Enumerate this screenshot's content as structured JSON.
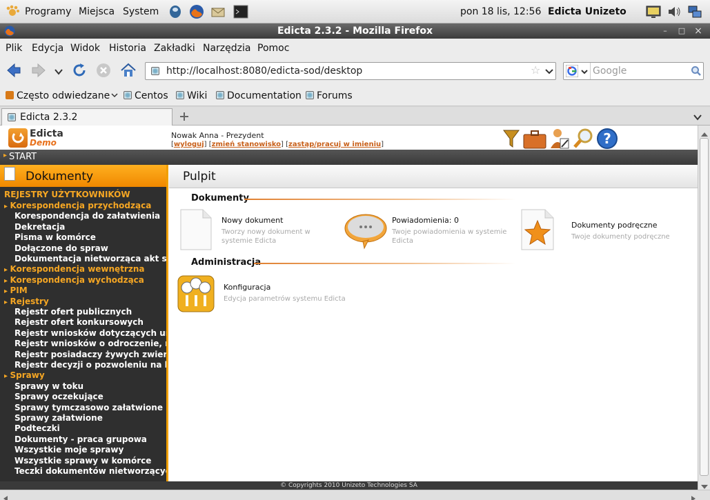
{
  "panel": {
    "menus": [
      "Programy",
      "Miejsca",
      "System"
    ],
    "clock": "pon 18 lis, 12:56",
    "user": "Edicta Unizeto"
  },
  "window": {
    "title": "Edicta 2.3.2 - Mozilla Firefox",
    "min": "–",
    "max": "□",
    "close": "×"
  },
  "menubar": [
    "Plik",
    "Edycja",
    "Widok",
    "Historia",
    "Zakładki",
    "Narzędzia",
    "Pomoc"
  ],
  "nav": {
    "url": "http://localhost:8080/edicta-sod/desktop",
    "search_placeholder": "Google"
  },
  "bookmarks": [
    "Często odwiedzane",
    "Centos",
    "Wiki",
    "Documentation",
    "Forums"
  ],
  "tabs": [
    {
      "label": "Edicta 2.3.2"
    }
  ],
  "app": {
    "logo_line1": "Edicta",
    "logo_line2": "Demo",
    "user_info": "Nowak Anna - Prezydent",
    "links": [
      "wyloguj",
      "zmień stanowisko",
      "zastąp/pracuj w imieniu"
    ],
    "start": "START",
    "sidebar_title": "Dokumenty",
    "main_title": "Pulpit",
    "footer": "© Copyrights 2010 Unizeto Technologies SA"
  },
  "sidebar": {
    "section": "REJESTRY UŻYTKOWNIKÓW",
    "items": [
      {
        "label": "Korespondencja przychodząca",
        "type": "group"
      },
      {
        "label": "Korespondencja do załatwienia",
        "type": "sub"
      },
      {
        "label": "Dekretacja",
        "type": "sub"
      },
      {
        "label": "Pisma w komórce",
        "type": "sub"
      },
      {
        "label": "Dołączone do spraw",
        "type": "sub"
      },
      {
        "label": "Dokumentacja nietworząca akt sprawy",
        "type": "sub"
      },
      {
        "label": "Korespondencja wewnętrzna",
        "type": "group"
      },
      {
        "label": "Korespondencja wychodząca",
        "type": "group"
      },
      {
        "label": "PIM",
        "type": "group"
      },
      {
        "label": "Rejestry",
        "type": "group"
      },
      {
        "label": "Rejestr ofert publicznych",
        "type": "sub"
      },
      {
        "label": "Rejestr ofert konkursowych",
        "type": "sub"
      },
      {
        "label": "Rejestr wniosków dotyczących umorzenia",
        "type": "sub"
      },
      {
        "label": "Rejestr wniosków o odroczenie, rozłożenie",
        "type": "sub"
      },
      {
        "label": "Rejestr posiadaczy żywych zwierząt",
        "type": "sub"
      },
      {
        "label": "Rejestr decyzji o pozwoleniu na budowę",
        "type": "sub"
      },
      {
        "label": "Sprawy",
        "type": "group"
      },
      {
        "label": "Sprawy w toku",
        "type": "sub"
      },
      {
        "label": "Sprawy oczekujące",
        "type": "sub"
      },
      {
        "label": "Sprawy tymczasowo załatwione",
        "type": "sub"
      },
      {
        "label": "Sprawy załatwione",
        "type": "sub"
      },
      {
        "label": "Podteczki",
        "type": "sub"
      },
      {
        "label": "Dokumenty - praca grupowa",
        "type": "sub"
      },
      {
        "label": "Wszystkie moje sprawy",
        "type": "sub"
      },
      {
        "label": "Wszystkie sprawy w komórce",
        "type": "sub"
      },
      {
        "label": "Teczki dokumentów nietworzących spraw",
        "type": "sub"
      }
    ]
  },
  "main": {
    "sections": [
      {
        "title": "Dokumenty",
        "items": [
          {
            "title": "Nowy dokument",
            "desc": "Tworzy nowy dokument w systemie Edicta",
            "icon": "document-icon"
          },
          {
            "title": "Powiadomienia: 0",
            "desc": "Twoje powiadomienia w systemie Edicta",
            "icon": "speech-bubble-icon"
          },
          {
            "title": "Dokumenty podręczne",
            "desc": "Twoje dokumenty podręczne",
            "icon": "star-document-icon"
          }
        ]
      },
      {
        "title": "Administracja",
        "items": [
          {
            "title": "Konfiguracja",
            "desc": "Edycja parametrów systemu Edicta",
            "icon": "config-icon"
          }
        ]
      }
    ]
  }
}
